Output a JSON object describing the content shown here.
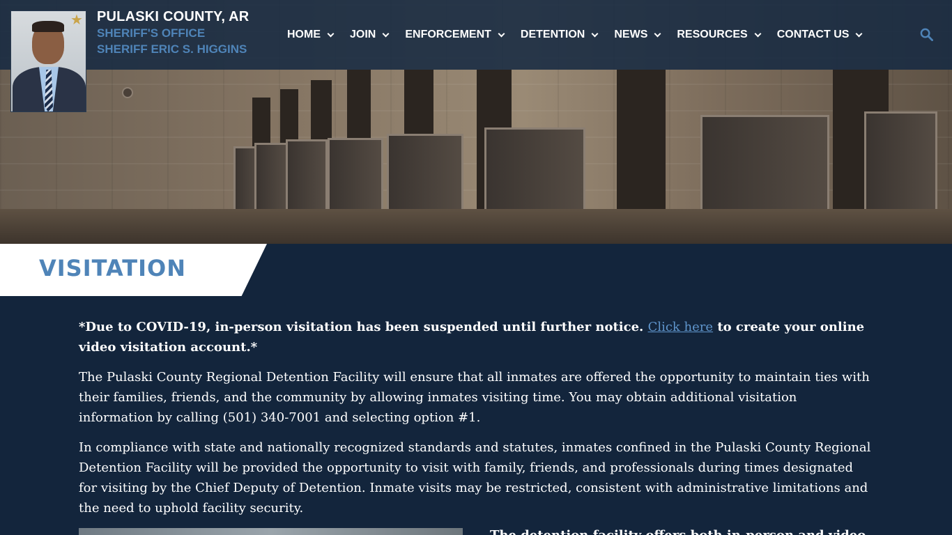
{
  "header": {
    "brand_title": "PULASKI COUNTY, AR",
    "brand_sub1": "SHERIFF'S OFFICE",
    "brand_sub2": "SHERIFF ERIC S. HIGGINS",
    "logo_icon": "star-badge-icon"
  },
  "nav": {
    "items": [
      {
        "label": "HOME"
      },
      {
        "label": "JOIN"
      },
      {
        "label": "ENFORCEMENT"
      },
      {
        "label": "DETENTION"
      },
      {
        "label": "NEWS"
      },
      {
        "label": "RESOURCES"
      },
      {
        "label": "CONTACT US"
      }
    ],
    "search_icon": "search-icon"
  },
  "page": {
    "title": "VISITATION",
    "notice_pre": "*Due to COVID-19, in-person visitation has been suspended until further notice. ",
    "notice_link": "Click here",
    "notice_post": " to create your online video visitation account.*",
    "para1": "The Pulaski County Regional Detention Facility will ensure that all inmates are offered the opportunity to maintain ties with their families, friends, and the community by allowing inmates visiting time. You may obtain additional visitation information by calling (501) 340-7001 and selecting option #1.",
    "para2": "In compliance with state and nationally recognized standards and statutes, inmates confined in the Pulaski County Regional Detention Facility will be provided the opportunity to visit with family, friends, and professionals during times designated for visiting by the Chief Deputy of Detention. Inmate visits may be restricted, consistent with administrative limitations and the need to uphold facility security.",
    "partial_text": "The detention facility offers both in-person and video"
  },
  "colors": {
    "navy": "#13253c",
    "accent_blue": "#4f84b8",
    "link_blue": "#5f95cc"
  }
}
